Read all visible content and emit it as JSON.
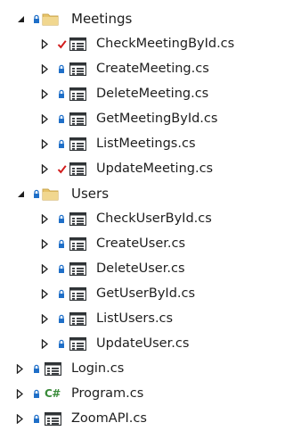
{
  "explorer": {
    "folders": [
      {
        "name": "Meetings",
        "files": [
          {
            "name": "CheckMeetingById.cs",
            "status": "checked-out"
          },
          {
            "name": "CreateMeeting.cs",
            "status": "locked"
          },
          {
            "name": "DeleteMeeting.cs",
            "status": "locked"
          },
          {
            "name": "GetMeetingById.cs",
            "status": "locked"
          },
          {
            "name": "ListMeetings.cs",
            "status": "locked"
          },
          {
            "name": "UpdateMeeting.cs",
            "status": "checked-out"
          }
        ]
      },
      {
        "name": "Users",
        "files": [
          {
            "name": "CheckUserById.cs",
            "status": "locked"
          },
          {
            "name": "CreateUser.cs",
            "status": "locked"
          },
          {
            "name": "DeleteUser.cs",
            "status": "locked"
          },
          {
            "name": "GetUserById.cs",
            "status": "locked"
          },
          {
            "name": "ListUsers.cs",
            "status": "locked"
          },
          {
            "name": "UpdateUser.cs",
            "status": "locked"
          }
        ]
      }
    ],
    "root_files": [
      {
        "name": "Login.cs",
        "status": "locked",
        "icon": "class-file-icon"
      },
      {
        "name": "Program.cs",
        "status": "locked",
        "icon": "csharp-file-icon"
      },
      {
        "name": "ZoomAPI.cs",
        "status": "locked",
        "icon": "class-file-icon"
      }
    ],
    "csharp_glyph": "C#",
    "colors": {
      "lock_blue": "#1f6fc8",
      "check_red": "#d11b1b",
      "folder_yellow": "#e8c46a",
      "class_icon": "#2f3336",
      "csharp_green": "#3a8b3a",
      "arrow": "#1e1e1e"
    }
  }
}
